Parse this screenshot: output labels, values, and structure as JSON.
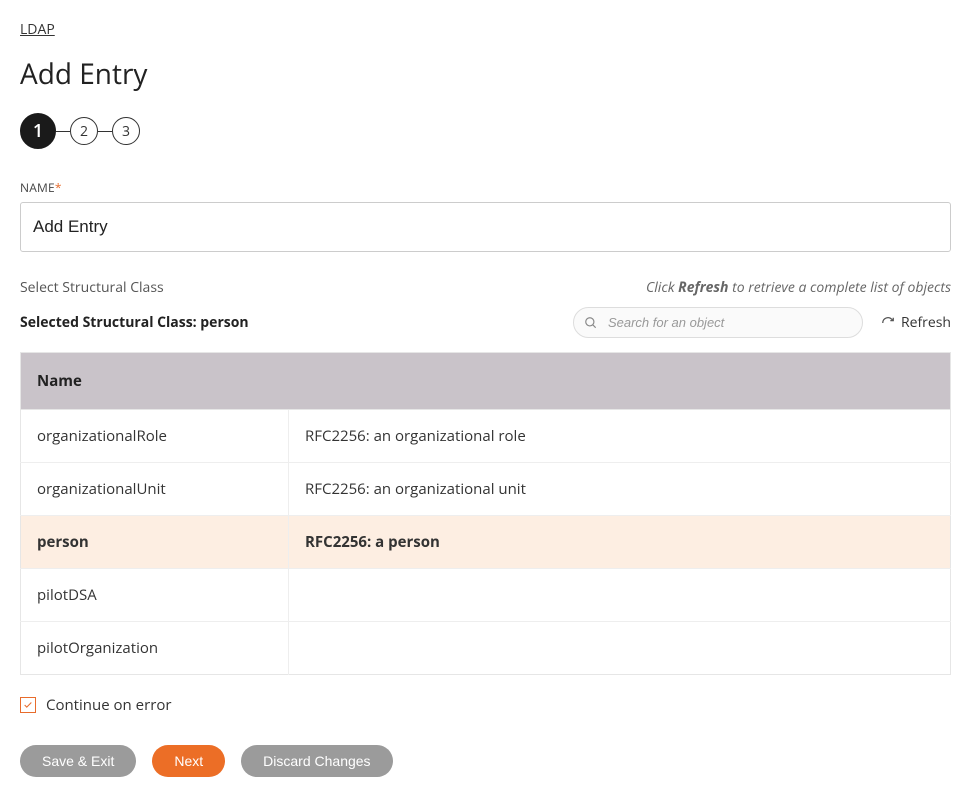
{
  "breadcrumb": {
    "link": "LDAP"
  },
  "page": {
    "title": "Add Entry"
  },
  "stepper": {
    "steps": [
      "1",
      "2",
      "3"
    ],
    "activeIndex": 0
  },
  "form": {
    "name_label": "NAME",
    "name_value": "Add Entry",
    "select_label": "Select Structural Class",
    "refresh_hint_prefix": "Click ",
    "refresh_hint_bold": "Refresh",
    "refresh_hint_suffix": " to retrieve a complete list of objects",
    "selected_class_label": "Selected Structural Class: person",
    "search_placeholder": "Search for an object",
    "refresh_label": "Refresh",
    "continue_label": "Continue on error",
    "continue_checked": true
  },
  "table": {
    "header_name": "Name",
    "rows": [
      {
        "name": "organizationalRole",
        "desc": "RFC2256: an organizational role",
        "selected": false
      },
      {
        "name": "organizationalUnit",
        "desc": "RFC2256: an organizational unit",
        "selected": false
      },
      {
        "name": "person",
        "desc": "RFC2256: a person",
        "selected": true
      },
      {
        "name": "pilotDSA",
        "desc": "",
        "selected": false
      },
      {
        "name": "pilotOrganization",
        "desc": "",
        "selected": false
      }
    ]
  },
  "buttons": {
    "save_exit": "Save & Exit",
    "next": "Next",
    "discard": "Discard Changes"
  }
}
